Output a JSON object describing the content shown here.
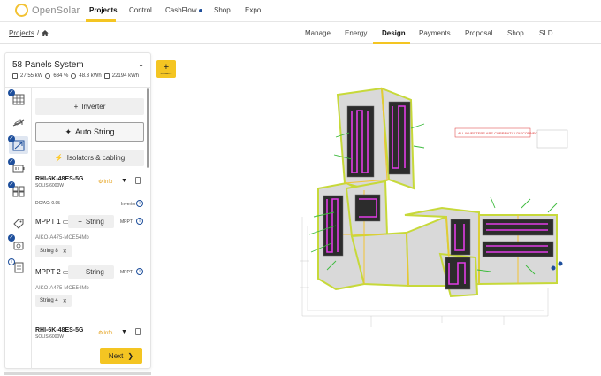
{
  "app": {
    "logo_text": "OpenSolar"
  },
  "topnav": {
    "items": [
      "Projects",
      "Control",
      "CashFlow",
      "Shop",
      "Expo"
    ],
    "active": "Projects"
  },
  "breadcrumb": {
    "root": "Projects",
    "separator": "/"
  },
  "tabs": {
    "items": [
      "Manage",
      "Energy",
      "Design",
      "Payments",
      "Proposal",
      "Shop",
      "SLD"
    ],
    "active": "Design"
  },
  "system": {
    "title": "58 Panels System",
    "stats": {
      "size": "27.55 kW",
      "offset": "634 %",
      "production_1": "48.3 kWh",
      "production_2": "22194 kWh"
    }
  },
  "panel": {
    "inverter_button": "Inverter",
    "auto_string_button": "Auto String",
    "isolators_button": "Isolators & cabling",
    "dcac": "DC/AC: 0.95",
    "inverter_label": "Inverter",
    "info_label": "Info",
    "next_button": "Next",
    "inverters": [
      {
        "name": "RHI-6K-48ES-5G",
        "maker": "SOLIS 6000W"
      },
      {
        "name": "RHI-6K-48ES-5G",
        "maker": "SOLIS 6000W"
      }
    ],
    "mppts": [
      {
        "title": "MPPT 1",
        "string_button": "String",
        "label": "MPPT",
        "module": "AIKO-A475-MCE54Mb",
        "string": "String 8"
      },
      {
        "title": "MPPT 2",
        "string_button": "String",
        "label": "MPPT",
        "module": "AIKO-A475-MCE54Mb",
        "string": "String 4"
      }
    ]
  },
  "panels_button": {
    "label": "PANELS"
  },
  "map": {
    "warning_text": "ALL INVERTERS ARE CURRENTLY DISCONNECTED"
  },
  "colors": {
    "accent": "#f4c522",
    "brand_blue": "#1e4f9c",
    "string_wire": "#e23ce6",
    "panel_outline": "#c7d93a"
  }
}
